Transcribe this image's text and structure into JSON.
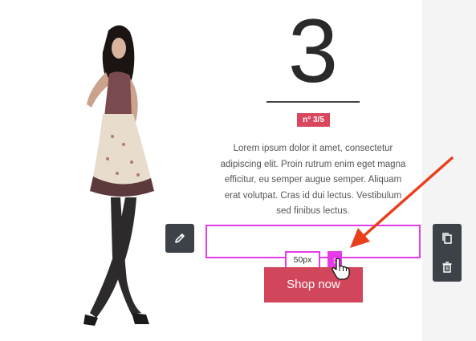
{
  "hero": {
    "number": "3",
    "badge": "n° 3/5",
    "body": "Lorem ipsum dolor it amet, consectetur adipiscing elit. Proin rutrum enim eget magna efficitur, eu semper augue semper. Aliquam erat volutpat. Cras id dui lectus. Vestibulum sed finibus lectus.",
    "button_label": "Shop now"
  },
  "spacer": {
    "size_label": "50px"
  },
  "toolbar": {
    "edit_icon": "pencil-icon",
    "duplicate_icon": "copy-icon",
    "delete_icon": "trash-icon"
  },
  "colors": {
    "accent": "#d2465c",
    "selection": "#e63be6",
    "tool_bg": "#3d4148",
    "annotation_arrow": "#e8401c"
  }
}
